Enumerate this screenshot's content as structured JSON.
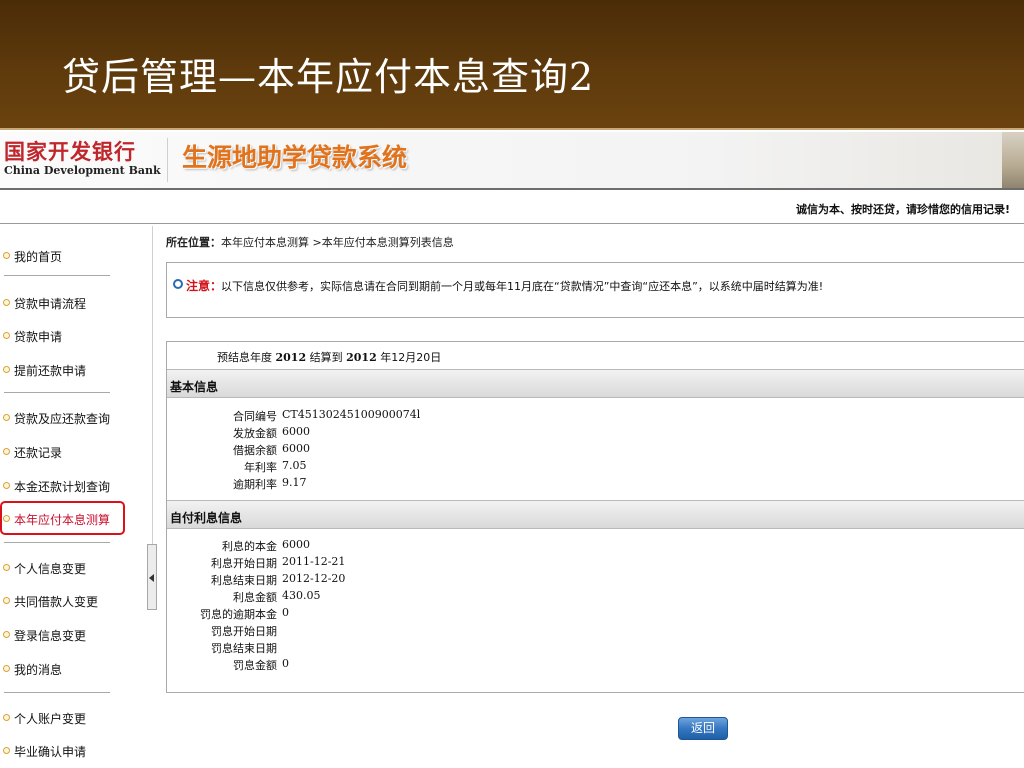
{
  "slide": {
    "title": "贷后管理—本年应付本息查询2"
  },
  "banner": {
    "bank_name_cn": "国家开发银行",
    "bank_name_en": "China Development Bank",
    "system_name": "生源地助学贷款系统",
    "slogan": "诚信为本、按时还贷，请珍惜您的信用记录!"
  },
  "colors": {
    "header_brown": "#5e3a0c",
    "bank_red": "#c0272d",
    "system_orange": "#e0731c",
    "highlight_red": "#d9121a",
    "button_blue": "#3577c2"
  },
  "sidebar": {
    "active_item": "本年应付本息测算",
    "items": [
      {
        "label": "我的首页"
      },
      {
        "label": "贷款申请流程"
      },
      {
        "label": "贷款申请"
      },
      {
        "label": "提前还款申请"
      },
      {
        "label": "贷款及应还款查询"
      },
      {
        "label": "还款记录"
      },
      {
        "label": "本金还款计划查询"
      },
      {
        "label": "本年应付本息测算"
      },
      {
        "label": "个人信息变更"
      },
      {
        "label": "共同借款人变更"
      },
      {
        "label": "登录信息变更"
      },
      {
        "label": "我的消息"
      },
      {
        "label": "个人账户变更"
      },
      {
        "label": "毕业确认申请"
      }
    ]
  },
  "breadcrumb": {
    "label": "所在位置：",
    "path": "本年应付本息测算 >本年应付本息测算列表信息"
  },
  "notice": {
    "title": "注意：",
    "text": "以下信息仅供参考，实际信息请在合同到期前一个月或每年11月底在“贷款情况”中查询“应还本息”，以系统中届时结算为准!"
  },
  "settlement": {
    "prefix": "预结息年度",
    "year": "2012",
    "mid": "结算到",
    "to_year": "2012",
    "suffix": "年12月20日"
  },
  "basic_info": {
    "heading": "基本信息",
    "rows": [
      {
        "label": "合同编号",
        "value": "CT45130245100900074l"
      },
      {
        "label": "发放金额",
        "value": "6000"
      },
      {
        "label": "借据余额",
        "value": "6000"
      },
      {
        "label": "年利率",
        "value": "7.05"
      },
      {
        "label": "逾期利率",
        "value": "9.17"
      }
    ]
  },
  "interest_info": {
    "heading": "自付利息信息",
    "rows": [
      {
        "label": "利息的本金",
        "value": "6000"
      },
      {
        "label": "利息开始日期",
        "value": "2011-12-21"
      },
      {
        "label": "利息结束日期",
        "value": "2012-12-20"
      },
      {
        "label": "利息金额",
        "value": "430.05"
      },
      {
        "label": "罚息的逾期本金",
        "value": "0"
      },
      {
        "label": "罚息开始日期",
        "value": ""
      },
      {
        "label": "罚息结束日期",
        "value": ""
      },
      {
        "label": "罚息金额",
        "value": "0"
      }
    ]
  },
  "actions": {
    "back_label": "返回"
  }
}
